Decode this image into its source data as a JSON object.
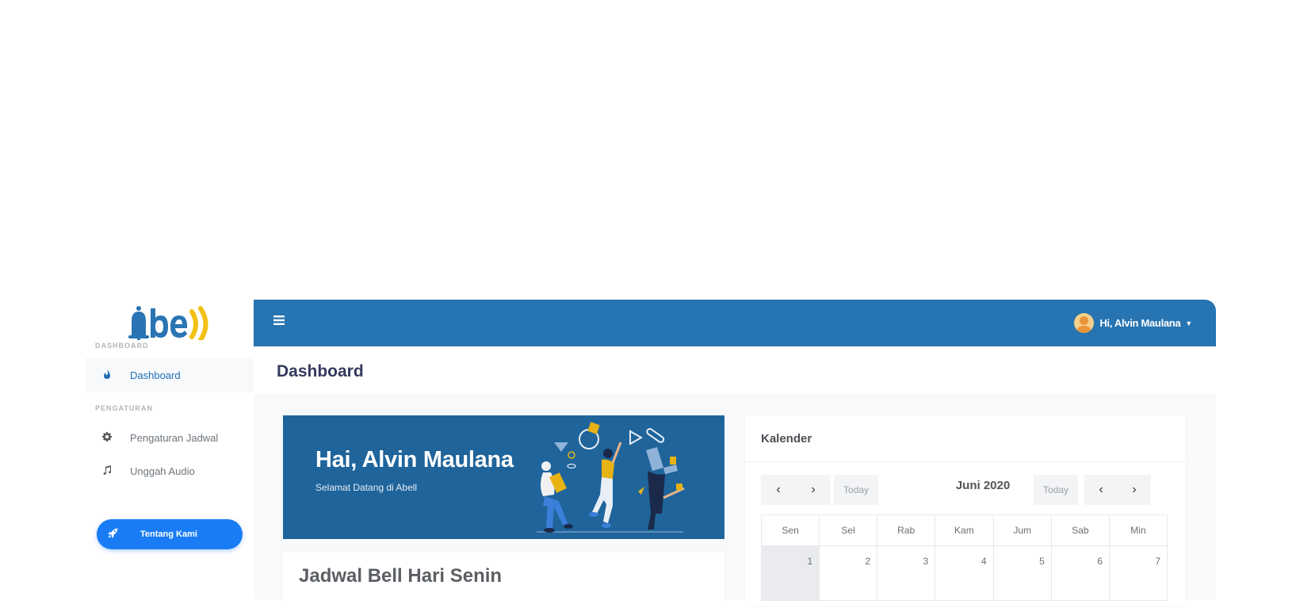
{
  "app": {
    "logo_text": "abell"
  },
  "sidebar": {
    "sections": [
      {
        "label": "DASHBOARD"
      },
      {
        "label": "PENGATURAN"
      }
    ],
    "items": [
      {
        "label": "Dashboard",
        "icon": "fire-icon",
        "active": true
      },
      {
        "label": "Pengaturan Jadwal",
        "icon": "gear-icon",
        "active": false
      },
      {
        "label": "Unggah Audio",
        "icon": "music-icon",
        "active": false
      }
    ],
    "about_button": {
      "label": "Tentang Kami",
      "icon": "rocket-icon"
    }
  },
  "topbar": {
    "menu_icon": "hamburger-icon",
    "user_greeting": "Hi, Alvin Maulana"
  },
  "page": {
    "title": "Dashboard"
  },
  "hero": {
    "title": "Hai, Alvin Maulana",
    "subtitle": "Selamat Datang di Abell"
  },
  "schedule": {
    "title": "Jadwal Bell Hari Senin"
  },
  "calendar": {
    "title": "Kalender",
    "month_label": "Juni 2020",
    "today_label": "Today",
    "weekdays": [
      "Sen",
      "Sel",
      "Rab",
      "Kam",
      "Jum",
      "Sab",
      "Min"
    ],
    "first_week": [
      "1",
      "2",
      "3",
      "4",
      "5",
      "6",
      "7"
    ]
  },
  "colors": {
    "topbar": "#2674b1",
    "hero": "#1f649b",
    "accent_button": "#1a7cf5",
    "logo_blue": "#2a74b3",
    "logo_yellow": "#f2c114"
  }
}
